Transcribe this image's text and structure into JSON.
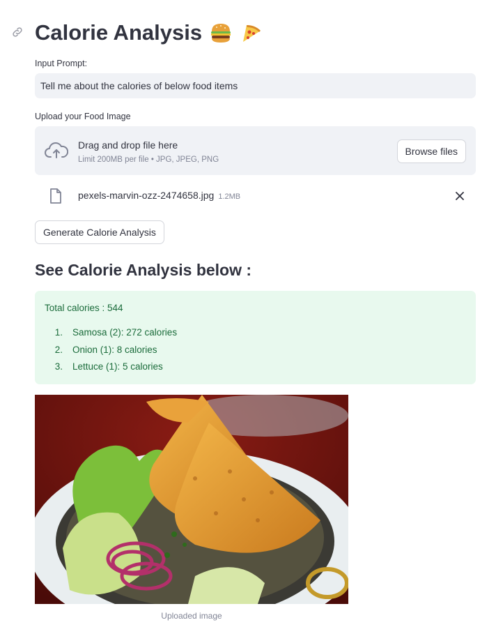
{
  "header": {
    "title": "Calorie Analysis",
    "emojis": [
      "hamburger-emoji",
      "pizza-emoji"
    ]
  },
  "prompt": {
    "label": "Input Prompt:",
    "value": "Tell me about the calories of below food items"
  },
  "upload": {
    "label": "Upload your Food Image",
    "drop_title": "Drag and drop file here",
    "drop_limit": "Limit 200MB per file • JPG, JPEG, PNG",
    "browse_label": "Browse files",
    "file_name": "pexels-marvin-ozz-2474658.jpg",
    "file_size": "1.2MB"
  },
  "actions": {
    "generate_label": "Generate Calorie Analysis"
  },
  "results": {
    "heading": "See Calorie Analysis below :",
    "total": "Total calories : 544",
    "items": [
      {
        "num": "1.",
        "text": "Samosa (2): 272 calories"
      },
      {
        "num": "2.",
        "text": "Onion (1): 8 calories"
      },
      {
        "num": "3.",
        "text": "Lettuce (1): 5 calories"
      }
    ]
  },
  "image": {
    "caption": "Uploaded image"
  },
  "colors": {
    "result_bg": "#e8f9ee",
    "result_text": "#1a6b3a",
    "input_bg": "#f0f2f6"
  }
}
